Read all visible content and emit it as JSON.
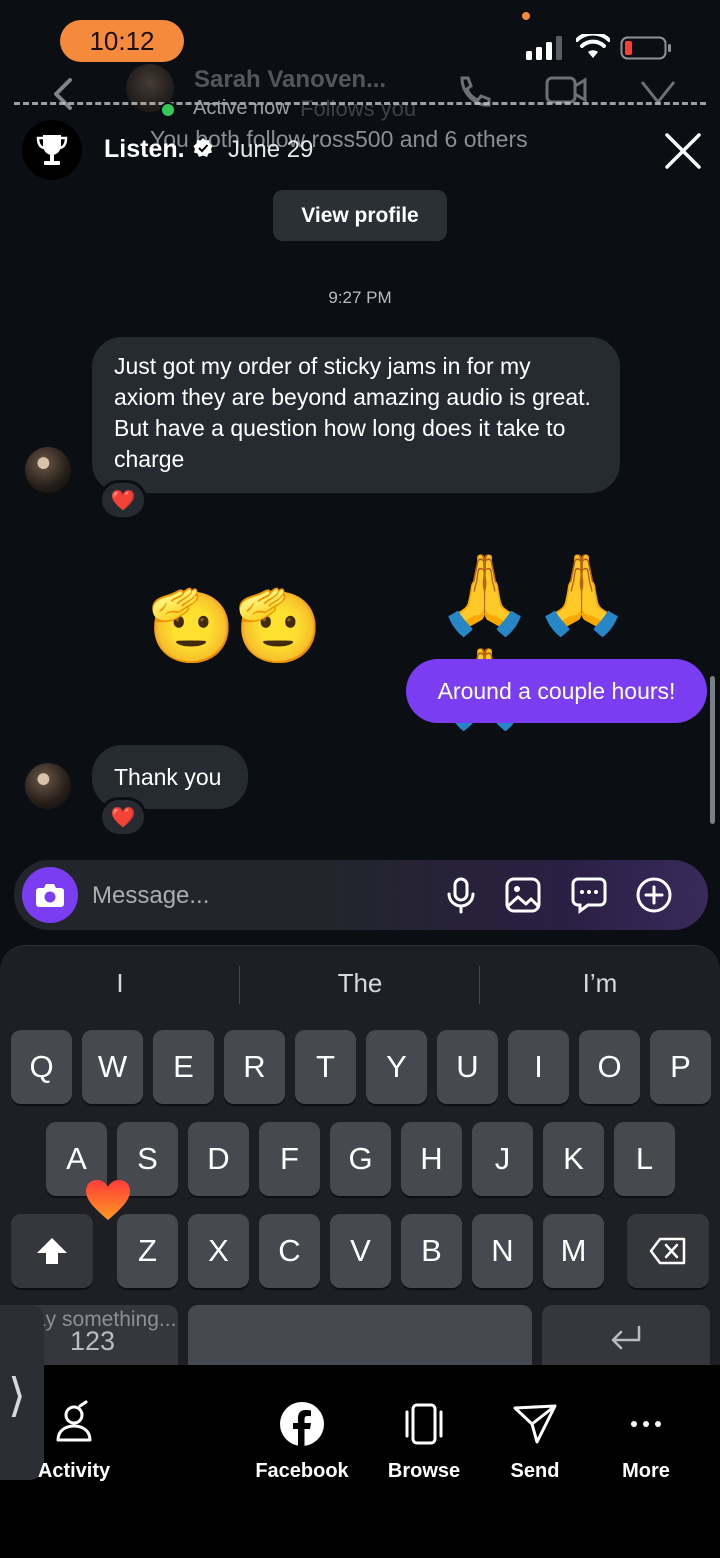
{
  "status_bar": {
    "time": "10:12"
  },
  "chat_header": {
    "contact_name": "Sarah Vanoven...",
    "follows_you": "Follows you",
    "active_status": "Active now",
    "mutual_follows": "You both follow ross500 and 6 others"
  },
  "story_overlay": {
    "account_name": "Listen.",
    "date": "June 29"
  },
  "profile": {
    "view_profile_label": "View profile"
  },
  "conversation": {
    "timestamp": "9:27 PM",
    "messages": [
      {
        "direction": "in",
        "text": "Just got my order of sticky jams in for my axiom they are beyond amazing audio is great. But have a question how long does it take to charge",
        "reaction": "❤️"
      },
      {
        "direction": "in",
        "text": "🫡🫡",
        "type": "emoji"
      },
      {
        "direction": "out",
        "text": "🙏🙏🙏",
        "type": "emoji"
      },
      {
        "direction": "out",
        "text": "Around a couple hours!"
      },
      {
        "direction": "in",
        "text": "Thank you",
        "reaction": "❤️"
      }
    ]
  },
  "composer": {
    "placeholder": "Message..."
  },
  "keyboard": {
    "suggestions": [
      "I",
      "The",
      "I’m"
    ],
    "row1": [
      "Q",
      "W",
      "E",
      "R",
      "T",
      "Y",
      "U",
      "I",
      "O",
      "P"
    ],
    "row2": [
      "A",
      "S",
      "D",
      "F",
      "G",
      "H",
      "J",
      "K",
      "L"
    ],
    "row3": [
      "Z",
      "X",
      "C",
      "V",
      "B",
      "N",
      "M"
    ],
    "numbers_label": "123",
    "dictation_hint": "ay something..."
  },
  "bottom_nav": {
    "items": [
      {
        "label": "Activity",
        "icon": "activity-icon"
      },
      {
        "label": "Facebook",
        "icon": "facebook-icon"
      },
      {
        "label": "Browse",
        "icon": "browse-icon"
      },
      {
        "label": "Send",
        "icon": "send-icon"
      },
      {
        "label": "More",
        "icon": "more-icon"
      }
    ]
  },
  "colors": {
    "background": "#0b0e13",
    "outgoing_bubble": "#7b3df2",
    "incoming_bubble": "#262a31",
    "time_pill": "#f58a3d"
  }
}
